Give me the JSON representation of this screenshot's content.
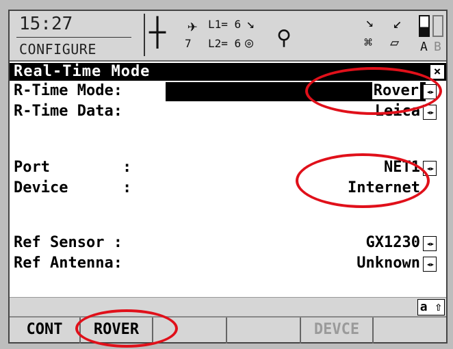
{
  "status": {
    "time": "15:27",
    "mode": "CONFIGURE",
    "sat_count": "7",
    "l1": "L1= 6",
    "l2": "L2= 6",
    "battery_a": "A",
    "battery_b": "B"
  },
  "icons": {
    "crosshair": "crosshair-icon",
    "satellite": "satellite-icon",
    "walker": "walker-icon",
    "arrows": "left-right-arrows-icon"
  },
  "title": "Real-Time Mode",
  "close_label": "×",
  "fields": [
    {
      "label": "R-Time Mode:",
      "value": "Rover"
    },
    {
      "label": "R-Time Data:",
      "value": "Leica"
    },
    {
      "label": "Port        :",
      "value": "NET1"
    },
    {
      "label": "Device      :",
      "value": "Internet"
    },
    {
      "label": "Ref Sensor :",
      "value": "GX1230"
    },
    {
      "label": "Ref Antenna:",
      "value": "Unknown"
    }
  ],
  "keyboard_indicator": "a ⇧",
  "softkeys": [
    "CONT",
    "ROVER",
    "",
    "",
    "DEVCE",
    ""
  ],
  "colors": {
    "highlight": "#e0101a",
    "selection": "#000000",
    "panel": "#d6d6d6"
  }
}
